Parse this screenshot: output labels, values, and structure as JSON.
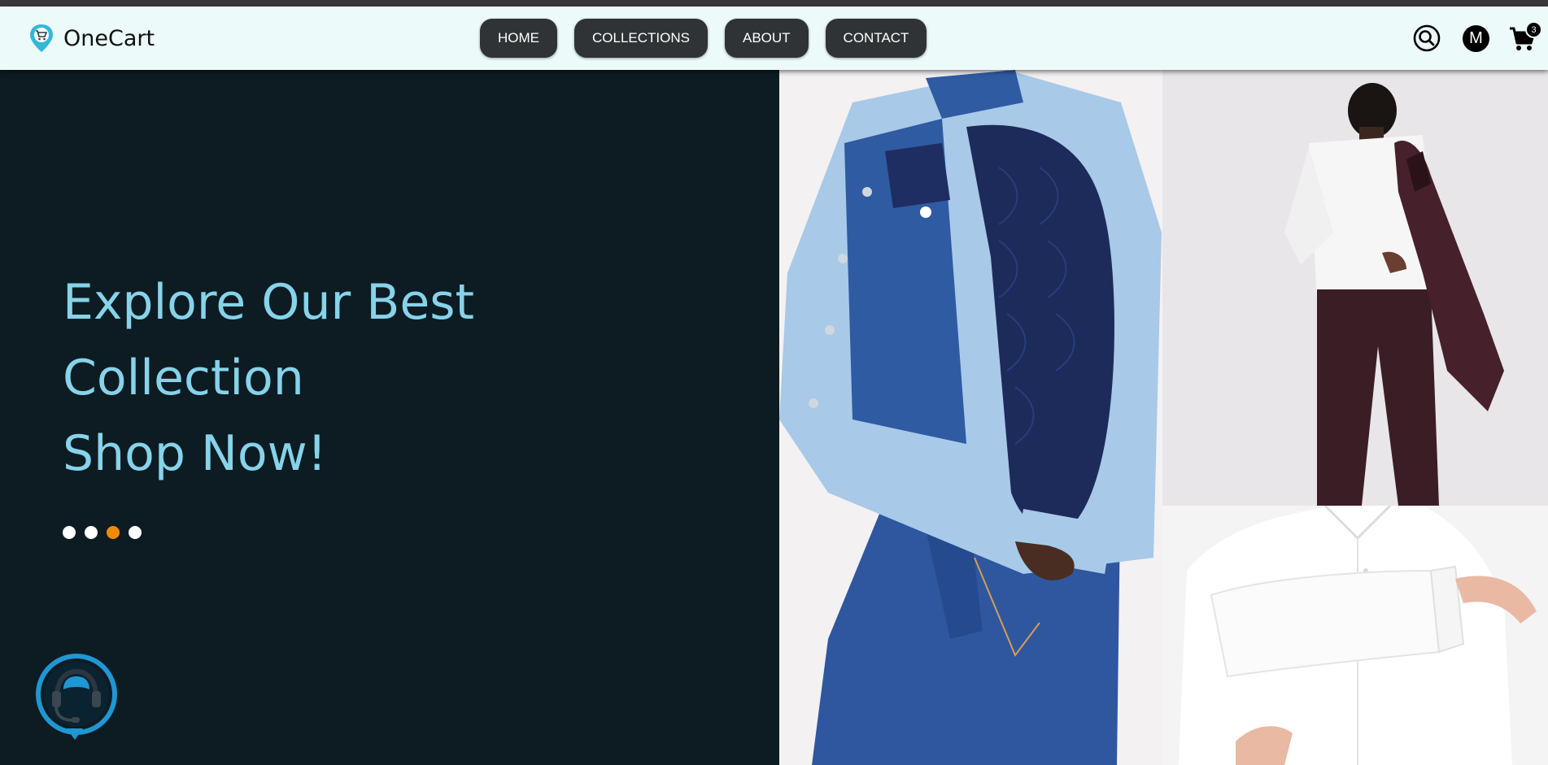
{
  "brand": {
    "name": "OneCart"
  },
  "nav": {
    "items": [
      {
        "label": "HOME"
      },
      {
        "label": "COLLECTIONS"
      },
      {
        "label": "ABOUT"
      },
      {
        "label": "CONTACT"
      }
    ]
  },
  "header": {
    "avatar_initial": "M",
    "cart_count": "3"
  },
  "hero": {
    "lines": [
      "Explore Our Best",
      "Collection",
      "Shop Now!"
    ],
    "slide_count": 4,
    "active_slide": 3
  },
  "colors": {
    "accent_text": "#86d3ea",
    "active_dot": "#f08a0b",
    "nav_button": "#2f3335",
    "navbar_bg": "#ecfbfa",
    "hero_bg": "#0d1c22"
  },
  "icons": {
    "logo": "cart-pin-icon",
    "search": "search-icon",
    "cart": "cart-icon",
    "support": "headset-chat-icon"
  }
}
